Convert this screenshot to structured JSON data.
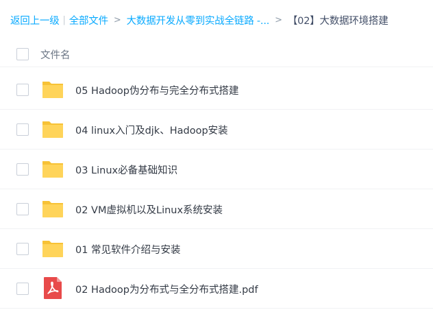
{
  "breadcrumb": {
    "back_label": "返回上一级",
    "pipe": "|",
    "all_files_label": "全部文件",
    "sep1": ">",
    "parent_folder_label": "大数据开发从零到实战全链路 -...",
    "sep2": ">",
    "current_folder_label": "【02】大数据环境搭建"
  },
  "list": {
    "column_header": "文件名",
    "items": [
      {
        "name": "05 Hadoop伪分布与完全分布式搭建",
        "type": "folder"
      },
      {
        "name": "04 linux入门及djk、Hadoop安装",
        "type": "folder"
      },
      {
        "name": "03 Linux必备基础知识",
        "type": "folder"
      },
      {
        "name": "02 VM虚拟机以及Linux系统安装",
        "type": "folder"
      },
      {
        "name": "01 常见软件介绍与安装",
        "type": "folder"
      },
      {
        "name": "02 Hadoop为分布式与全分布式搭建.pdf",
        "type": "pdf"
      }
    ]
  },
  "colors": {
    "link": "#09aaff",
    "folder": "#ffd45a",
    "pdf": "#e84a4a"
  },
  "icons": {
    "folder": "folder-icon",
    "pdf": "pdf-file-icon"
  }
}
